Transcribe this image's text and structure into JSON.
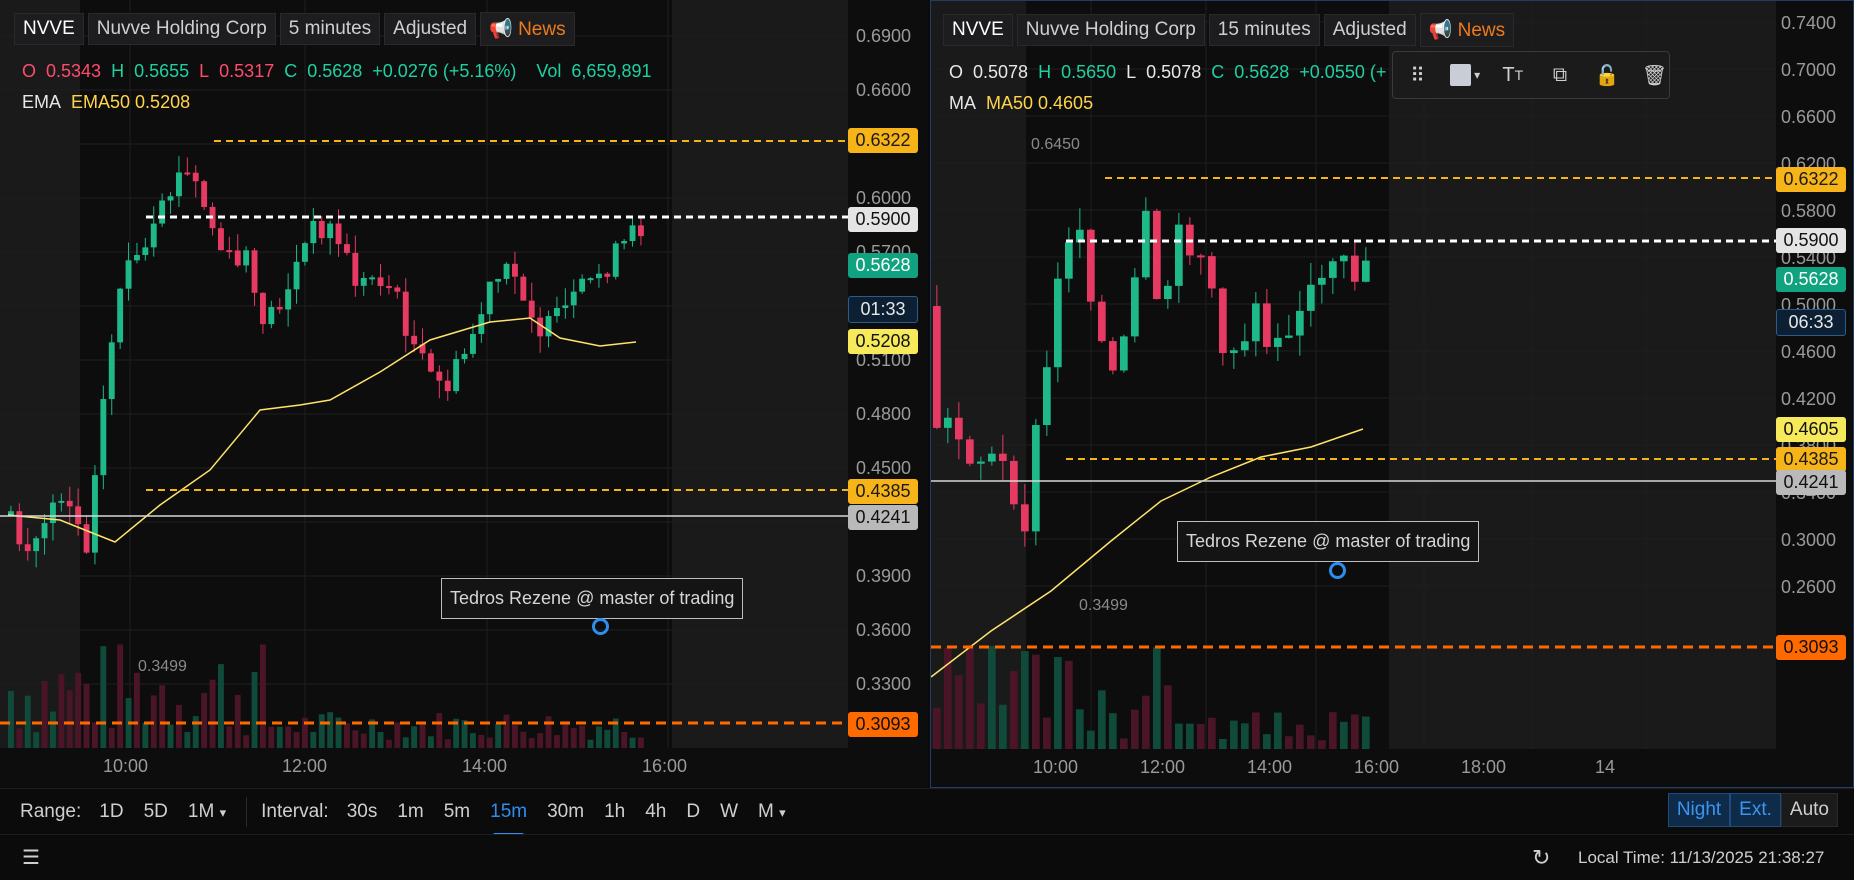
{
  "left": {
    "header": {
      "symbol": "NVVE",
      "company": "Nuvve Holding Corp",
      "interval": "5 minutes",
      "adjusted": "Adjusted",
      "news": "News"
    },
    "ohlc": {
      "o_label": "O",
      "o": "0.5343",
      "h_label": "H",
      "h": "0.5655",
      "l_label": "L",
      "l": "0.5317",
      "c_label": "C",
      "c": "0.5628",
      "change": "+0.0276 (+5.16%)",
      "vol_label": "Vol",
      "vol": "6,659,891"
    },
    "indicator": {
      "name": "EMA",
      "value": "EMA50 0.5208"
    },
    "axis": [
      "0.6900",
      "0.6600",
      "0.6300",
      "0.6000",
      "0.5700",
      "0.5400",
      "0.5100",
      "0.4800",
      "0.4500",
      "0.4200",
      "0.3900",
      "0.3600",
      "0.3300"
    ],
    "tags": {
      "upper": "0.6322",
      "white": "0.5900",
      "last": "0.5628",
      "timer": "01:33",
      "ema": "0.5208",
      "lower": "0.4385",
      "grey": "0.4241",
      "deep": "0.3093"
    },
    "low_label": "0.3499",
    "note": "Tedros Rezene @ master of trading",
    "xlabels": [
      "10:00",
      "12:00",
      "14:00",
      "16:00"
    ]
  },
  "right": {
    "header": {
      "symbol": "NVVE",
      "company": "Nuvve Holding Corp",
      "interval": "15 minutes",
      "adjusted": "Adjusted",
      "news": "News"
    },
    "ohlc": {
      "o_label": "O",
      "o": "0.5078",
      "h_label": "H",
      "h": "0.5650",
      "l_label": "L",
      "l": "0.5078",
      "c_label": "C",
      "c": "0.5628",
      "change": "+0.0550 (+"
    },
    "indicator": {
      "name": "MA",
      "value": "MA50 0.4605"
    },
    "axis": [
      "0.7400",
      "0.7000",
      "0.6600",
      "0.6200",
      "0.5800",
      "0.5400",
      "0.5000",
      "0.4600",
      "0.4200",
      "0.3800",
      "0.3400",
      "0.3000",
      "0.2600"
    ],
    "tags": {
      "upper": "0.6322",
      "white": "0.5900",
      "last": "0.5628",
      "timer": "06:33",
      "ma": "0.4605",
      "lower": "0.4385",
      "grey": "0.4241",
      "deep": "0.3093"
    },
    "high_label": "0.6450",
    "low_label": "0.3499",
    "note": "Tedros Rezene @ master of trading",
    "xlabels": [
      "10:00",
      "12:00",
      "14:00",
      "16:00",
      "18:00",
      "14"
    ]
  },
  "bottom": {
    "range_label": "Range:",
    "ranges": [
      "1D",
      "5D",
      "1M"
    ],
    "interval_label": "Interval:",
    "intervals": [
      "30s",
      "1m",
      "5m",
      "15m",
      "30m",
      "1h",
      "4h",
      "D",
      "W",
      "M"
    ],
    "active_interval": "15m",
    "session": [
      "Night",
      "Ext.",
      "Auto"
    ]
  },
  "status": {
    "local_time": "Local Time: 11/13/2025 21:38:27"
  },
  "colors": {
    "up": "#1fb889",
    "down": "#e63a62",
    "ema": "#ffe36a",
    "accent": "#2d8ef0"
  }
}
